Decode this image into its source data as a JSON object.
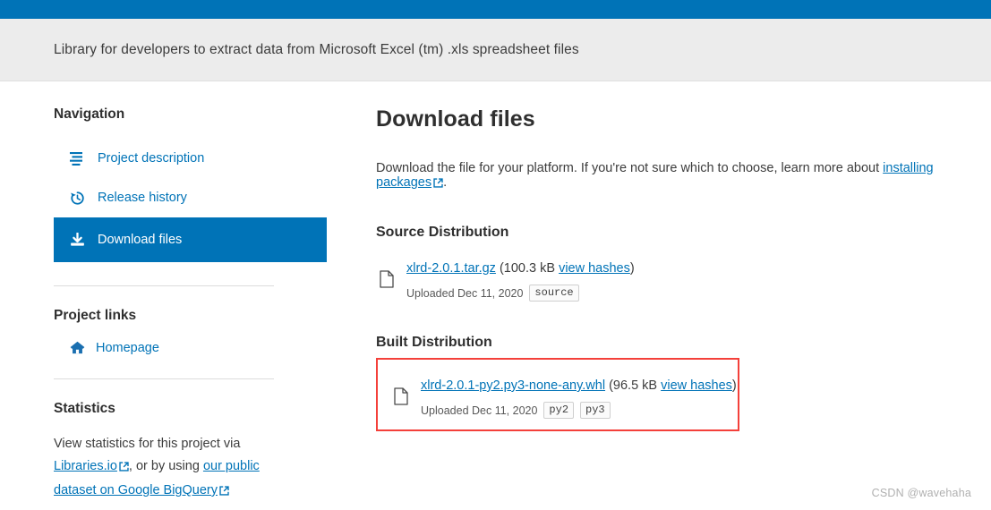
{
  "theme": {
    "brand_blue": "#0073b7",
    "banner_gray": "#ececec",
    "link_blue": "#0073b7",
    "annotation_red": "#f4403a",
    "watermark_gray": "#b0b0b0"
  },
  "banner": {
    "subtitle": "Library for developers to extract data from Microsoft Excel (tm) .xls spreadsheet files"
  },
  "sidebar": {
    "navigation_heading": "Navigation",
    "nav_items": [
      {
        "label": "Project description",
        "icon": "list-icon",
        "active": false
      },
      {
        "label": "Release history",
        "icon": "history-icon",
        "active": false
      },
      {
        "label": "Download files",
        "icon": "download-icon",
        "active": true
      }
    ],
    "project_links_heading": "Project links",
    "project_links": [
      {
        "label": "Homepage",
        "icon": "home-icon"
      }
    ],
    "statistics_heading": "Statistics",
    "statistics": {
      "prefix": "View statistics for this project via ",
      "link1": "Libraries.io",
      "middle": ", or by using ",
      "link2": "our public dataset on Google BigQuery"
    }
  },
  "main": {
    "title": "Download files",
    "description": {
      "prefix": "Download the file for your platform. If you're not sure which to choose, learn more about ",
      "link": "installing packages",
      "suffix": "."
    },
    "source_distribution": {
      "heading": "Source Distribution",
      "file": {
        "name": "xlrd-2.0.1.tar.gz",
        "size": "(100.3 kB ",
        "hashes_link": "view hashes",
        "paren_close": ")",
        "uploaded": "Uploaded Dec 11, 2020",
        "tags": [
          "source"
        ]
      }
    },
    "built_distribution": {
      "heading": "Built Distribution",
      "highlighted": true,
      "file": {
        "name": "xlrd-2.0.1-py2.py3-none-any.whl",
        "size": "(96.5 kB ",
        "hashes_link": "view hashes",
        "paren_close": ")",
        "uploaded": "Uploaded Dec 11, 2020",
        "tags": [
          "py2",
          "py3"
        ]
      }
    }
  },
  "watermark": {
    "text": "CSDN @wavehaha"
  }
}
